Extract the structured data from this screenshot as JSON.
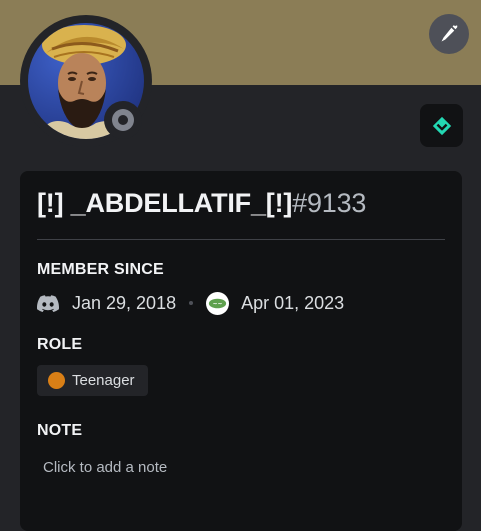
{
  "profile": {
    "username": "[!] _ABDELLATIF_[!]",
    "discriminator": "#9133",
    "banner_color": "#8b7d56",
    "status": "offline",
    "avatar_alt": "avatar"
  },
  "member_since": {
    "title": "MEMBER SINCE",
    "discord_date": "Jan 29, 2018",
    "server_date": "Apr 01, 2023",
    "discord_icon": "discord-icon",
    "server_icon": "server-icon"
  },
  "role": {
    "title": "ROLE",
    "name": "Teenager",
    "color": "#d97f16"
  },
  "note": {
    "title": "NOTE",
    "placeholder": "Click to add a note"
  },
  "actions": {
    "edit_icon": "pencil-icon",
    "badge_icon": "nitro-badge-icon"
  }
}
